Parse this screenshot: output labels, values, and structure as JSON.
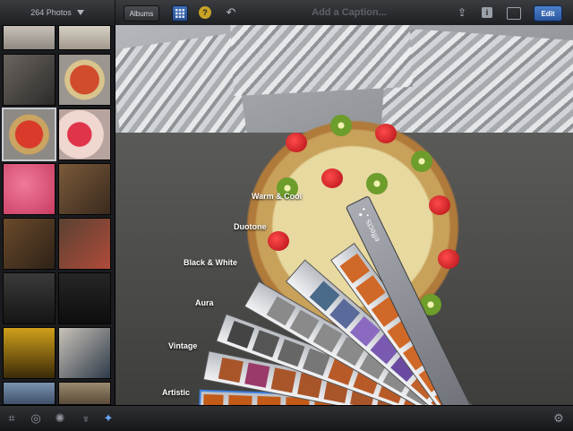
{
  "header": {
    "photo_count": "264 Photos",
    "albums_label": "Albums",
    "help_label": "?",
    "caption_placeholder": "Add a Caption...",
    "info_label": "i",
    "edit_label": "Edit"
  },
  "icons": {
    "grid": "grid-icon",
    "undo": "undo-icon",
    "share": "share-icon",
    "fullscreen": "fullscreen-icon",
    "crop": "crop-icon",
    "straighten": "straighten-icon",
    "exposure": "palette-icon",
    "brushes": "brushes-icon",
    "effects": "sparkle-icon",
    "settings": "gear-icon"
  },
  "effects_fan": {
    "handle_label": "effects",
    "items": [
      {
        "label": "Warm & Cool"
      },
      {
        "label": "Duotone"
      },
      {
        "label": "Black & White"
      },
      {
        "label": "Aura"
      },
      {
        "label": "Vintage"
      },
      {
        "label": "Artistic"
      }
    ],
    "selected": "Artistic"
  },
  "colors": {
    "accent": "#3f7fe0",
    "edit_button": "#2f5ea8"
  }
}
